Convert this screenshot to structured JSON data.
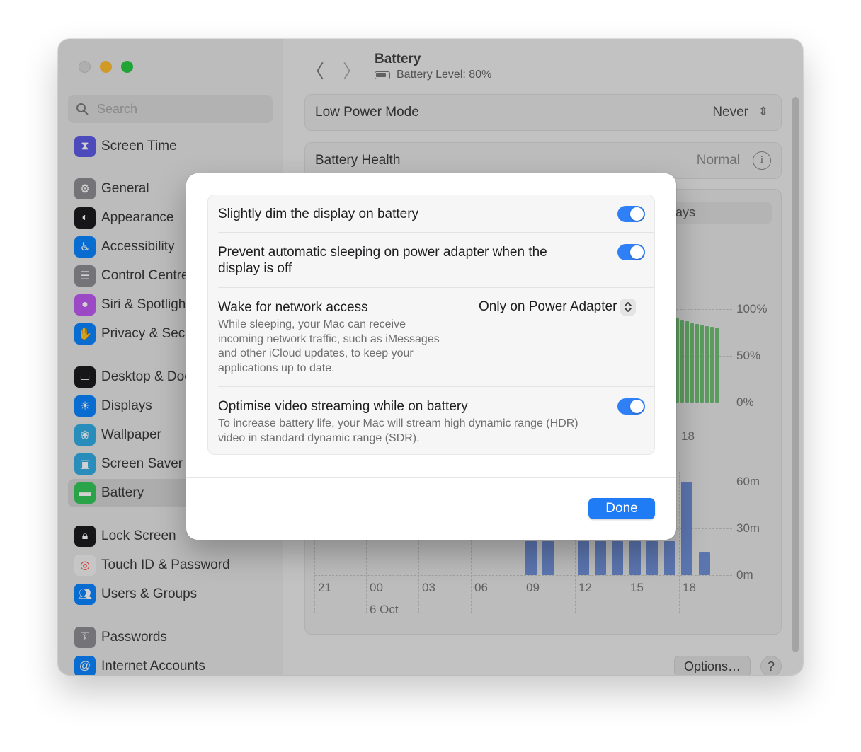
{
  "sidebar": {
    "search_placeholder": "Search",
    "items": [
      {
        "label": "Screen Time",
        "icon": "hourglass-icon",
        "color": "#5e5ce6"
      },
      {
        "label": "General",
        "icon": "gear-icon",
        "color": "#8e8e93"
      },
      {
        "label": "Appearance",
        "icon": "appearance-icon",
        "color": "#1c1c1e"
      },
      {
        "label": "Accessibility",
        "icon": "accessibility-icon",
        "color": "#0a84ff"
      },
      {
        "label": "Control Centre",
        "icon": "control-centre-icon",
        "color": "#8e8e93"
      },
      {
        "label": "Siri & Spotlight",
        "icon": "siri-icon",
        "color": "#bf5af2"
      },
      {
        "label": "Privacy & Security",
        "icon": "hand-icon",
        "color": "#0a84ff"
      },
      {
        "label": "Desktop & Dock",
        "icon": "dock-icon",
        "color": "#1c1c1e"
      },
      {
        "label": "Displays",
        "icon": "sun-icon",
        "color": "#0a84ff"
      },
      {
        "label": "Wallpaper",
        "icon": "flower-icon",
        "color": "#32ade6"
      },
      {
        "label": "Screen Saver",
        "icon": "screen-saver-icon",
        "color": "#32ade6"
      },
      {
        "label": "Battery",
        "icon": "battery-icon",
        "color": "#34c759"
      },
      {
        "label": "Lock Screen",
        "icon": "lock-icon",
        "color": "#1c1c1e"
      },
      {
        "label": "Touch ID & Password",
        "icon": "fingerprint-icon",
        "color": "#ff453a"
      },
      {
        "label": "Users & Groups",
        "icon": "users-icon",
        "color": "#0a84ff"
      },
      {
        "label": "Passwords",
        "icon": "key-icon",
        "color": "#8e8e93"
      },
      {
        "label": "Internet Accounts",
        "icon": "at-icon",
        "color": "#0a84ff"
      }
    ]
  },
  "header": {
    "title": "Battery",
    "subtitle": "Battery Level: 80%"
  },
  "settings": {
    "low_power_label": "Low Power Mode",
    "low_power_value": "Never",
    "health_label": "Battery Health",
    "health_value": "Normal",
    "segment_fragment": "ays"
  },
  "chart": {
    "level_ticks": [
      "100%",
      "50%",
      "0%"
    ],
    "usage_ticks": [
      "60m",
      "30m",
      "0m"
    ],
    "x_ticks": [
      "21",
      "00",
      "03",
      "06",
      "09",
      "12",
      "15",
      "18"
    ],
    "x_tick_top": "18",
    "date_label": "6 Oct",
    "colors": {
      "level": "#6fbf73",
      "usage": "#6f8fd6"
    }
  },
  "chart_data": [
    {
      "type": "bar",
      "ylabel": "",
      "ylim": [
        0,
        100
      ],
      "x_visible": [
        "18"
      ],
      "values": [
        90,
        88,
        87,
        85,
        84,
        83,
        82,
        81,
        80
      ]
    },
    {
      "type": "bar",
      "ylim": [
        0,
        60
      ],
      "categories": [
        "09",
        "10",
        "12",
        "13",
        "14",
        "15",
        "16",
        "17",
        "18",
        "19"
      ],
      "values": [
        22,
        22,
        22,
        22,
        22,
        22,
        22,
        22,
        60,
        15
      ]
    }
  ],
  "footer": {
    "options_label": "Options…",
    "help_label": "?"
  },
  "sheet": {
    "rows": [
      {
        "title": "Slightly dim the display on battery",
        "toggle": true
      },
      {
        "title": "Prevent automatic sleeping on power adapter when the display is off",
        "toggle": true
      },
      {
        "title": "Wake for network access",
        "value": "Only on Power Adapter",
        "desc": "While sleeping, your Mac can receive incoming network traffic, such as iMessages and other iCloud updates, to keep your applications up to date."
      },
      {
        "title": "Optimise video streaming while on battery",
        "toggle": true,
        "desc": "To increase battery life, your Mac will stream high dynamic range (HDR) video in standard dynamic range (SDR)."
      }
    ],
    "done_label": "Done"
  }
}
